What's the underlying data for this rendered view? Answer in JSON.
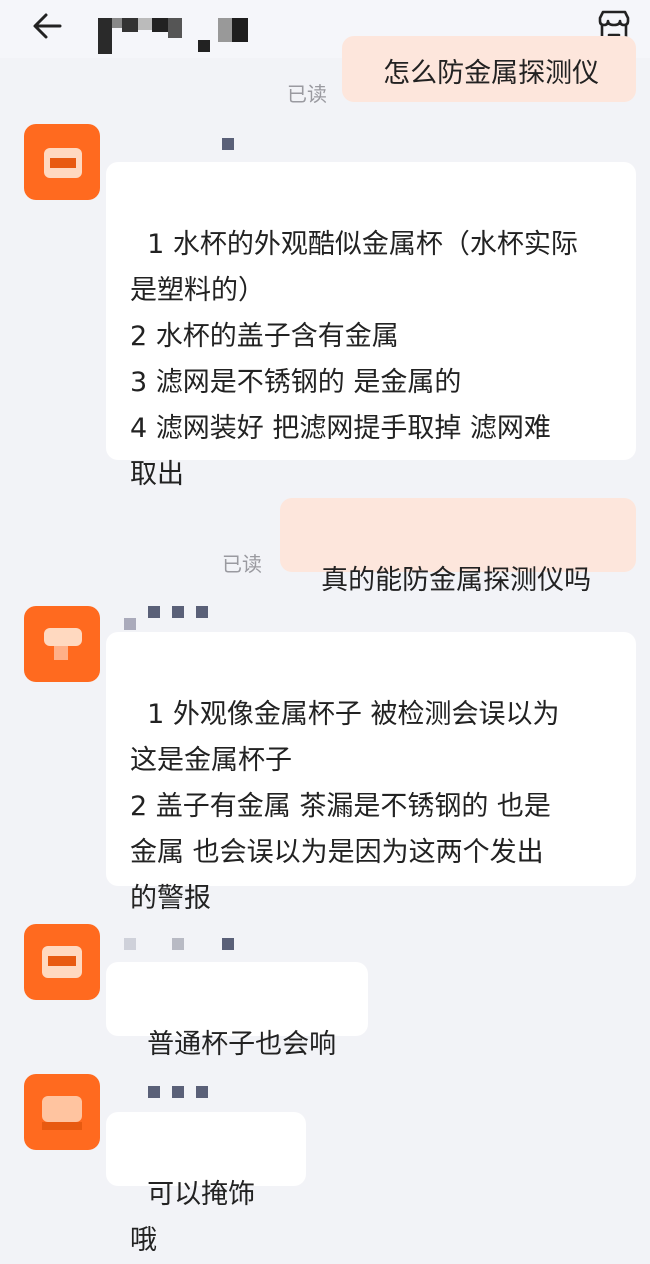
{
  "header": {
    "back_icon": "back-arrow-icon",
    "title": "",
    "shop_icon": "shop-icon"
  },
  "messages": [
    {
      "side": "out",
      "text": "怎么防金属探测仪",
      "read": "已读"
    },
    {
      "side": "in",
      "text": "1 水杯的外观酷似金属杯（水杯实际\n是塑料的）\n2 水杯的盖子含有金属\n3 滤网是不锈钢的 是金属的\n4 滤网装好 把滤网提手取掉 滤网难\n取出"
    },
    {
      "side": "out",
      "text": "真的能防金属探测仪吗",
      "read": "已读"
    },
    {
      "side": "in",
      "text": "1 外观像金属杯子 被检测会误以为\n这是金属杯子\n2 盖子有金属 茶漏是不锈钢的 也是\n金属 也会误以为是因为这两个发出\n的警报"
    },
    {
      "side": "in",
      "text": "普通杯子也会响"
    },
    {
      "side": "in",
      "text": "可以掩饰哦"
    }
  ],
  "colors": {
    "background": "#f2f3f7",
    "incoming_bubble": "#ffffff",
    "outgoing_bubble": "#fde6dc",
    "avatar": "#ff6a1f",
    "read_label": "#9a9aa0"
  }
}
